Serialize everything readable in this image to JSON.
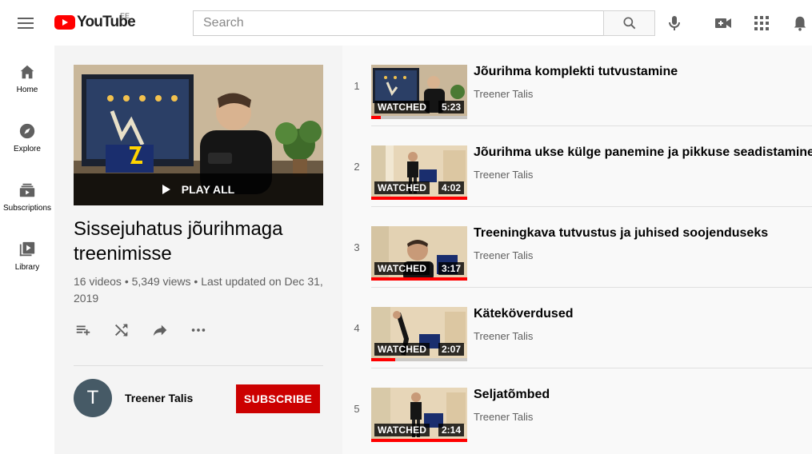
{
  "header": {
    "logo_text": "YouTube",
    "country_code": "EE",
    "search_placeholder": "Search",
    "icons": [
      "menu-icon",
      "search-icon",
      "microphone-icon",
      "create-video-icon",
      "apps-grid-icon",
      "notifications-bell-icon"
    ]
  },
  "guide": {
    "items": [
      {
        "label": "Home",
        "icon": "home-icon"
      },
      {
        "label": "Explore",
        "icon": "compass-icon"
      },
      {
        "label": "Subscriptions",
        "icon": "subscriptions-icon"
      },
      {
        "label": "Library",
        "icon": "library-icon"
      }
    ]
  },
  "playlist": {
    "play_all_label": "PLAY ALL",
    "title": "Sissejuhatus jõurihmaga treenimisse",
    "stats": "16 videos • 5,349 views • Last updated on Dec 31, 2019",
    "actions": [
      "save-to-queue-icon",
      "shuffle-icon",
      "share-icon",
      "more-icon"
    ],
    "owner": {
      "avatar_letter": "T",
      "name": "Treener Talis"
    },
    "subscribe_label": "SUBSCRIBE"
  },
  "videos": [
    {
      "index": "1",
      "title": "Jõurihma komplekti tutvustamine",
      "channel": "Treener Talis",
      "badge": "WATCHED",
      "duration": "5:23",
      "progress": 0.1
    },
    {
      "index": "2",
      "title": "Jõurihma ukse külge panemine ja pikkuse seadistamine",
      "channel": "Treener Talis",
      "badge": "WATCHED",
      "duration": "4:02",
      "progress": 1.0
    },
    {
      "index": "3",
      "title": "Treeningkava tutvustus ja juhised soojenduseks",
      "channel": "Treener Talis",
      "badge": "WATCHED",
      "duration": "3:17",
      "progress": 1.0
    },
    {
      "index": "4",
      "title": "Käteköverdused",
      "channel": "Treener Talis",
      "badge": "WATCHED",
      "duration": "2:07",
      "progress": 0.25
    },
    {
      "index": "5",
      "title": "Seljatõmbed",
      "channel": "Treener Talis",
      "badge": "WATCHED",
      "duration": "2:14",
      "progress": 1.0
    }
  ],
  "colors": {
    "brand_red": "#ff0000",
    "subscribe_red": "#cc0000",
    "avatar_bg": "#465a66"
  }
}
